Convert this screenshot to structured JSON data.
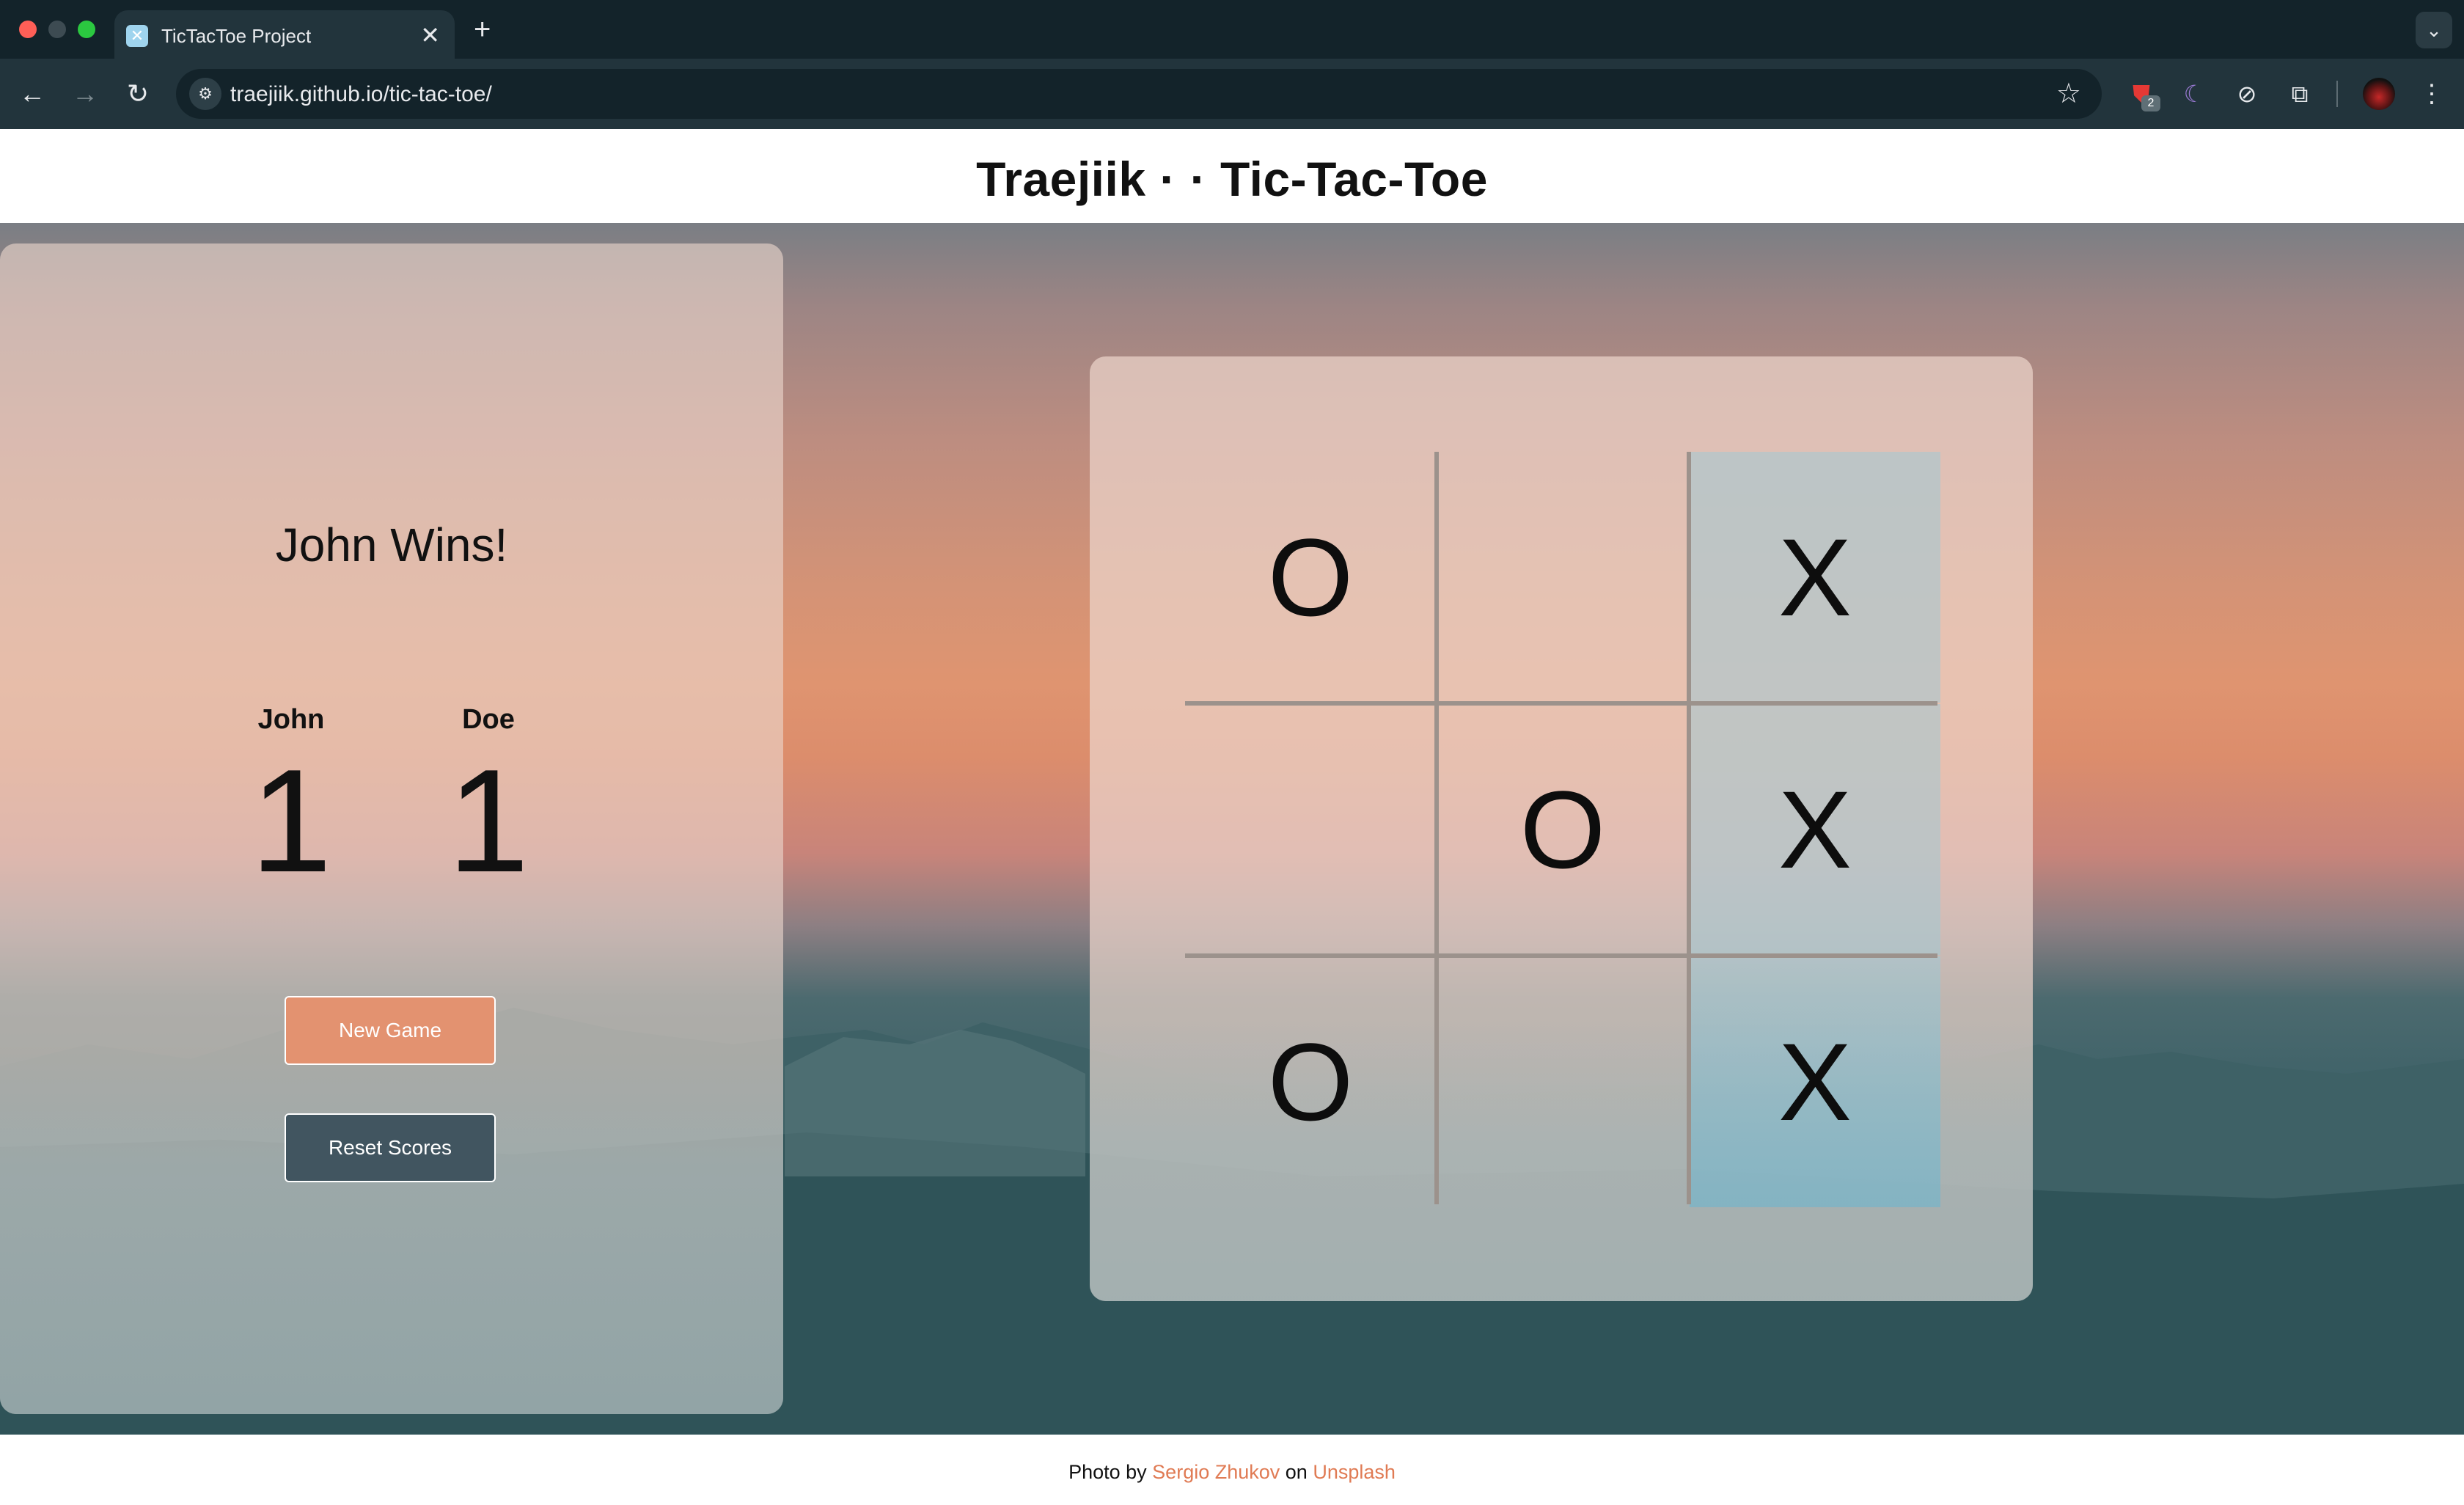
{
  "browser": {
    "tab_title": "TicTacToe Project",
    "tab_close": "✕",
    "new_tab": "+",
    "tab_menu": "⌄",
    "url": "traejiik.github.io/tic-tac-toe/",
    "extension_badge": "2"
  },
  "header": {
    "title": "Traejiik · · Tic-Tac-Toe"
  },
  "game": {
    "status": "John Wins!",
    "players": [
      {
        "name": "John",
        "score": "1"
      },
      {
        "name": "Doe",
        "score": "1"
      }
    ],
    "new_game_label": "New Game",
    "reset_scores_label": "Reset Scores",
    "board": [
      "O",
      "",
      "X",
      "",
      "O",
      "X",
      "O",
      "",
      "X"
    ],
    "winning_cells": [
      2,
      5,
      8
    ]
  },
  "footer": {
    "prefix": "Photo by",
    "photographer": "Sergio Zhukov",
    "middle": "on",
    "source": "Unsplash"
  },
  "colors": {
    "accent": "#e39270",
    "reset_button": "#415560",
    "link": "#e07b54",
    "win_highlight": "#a0c8d4"
  }
}
